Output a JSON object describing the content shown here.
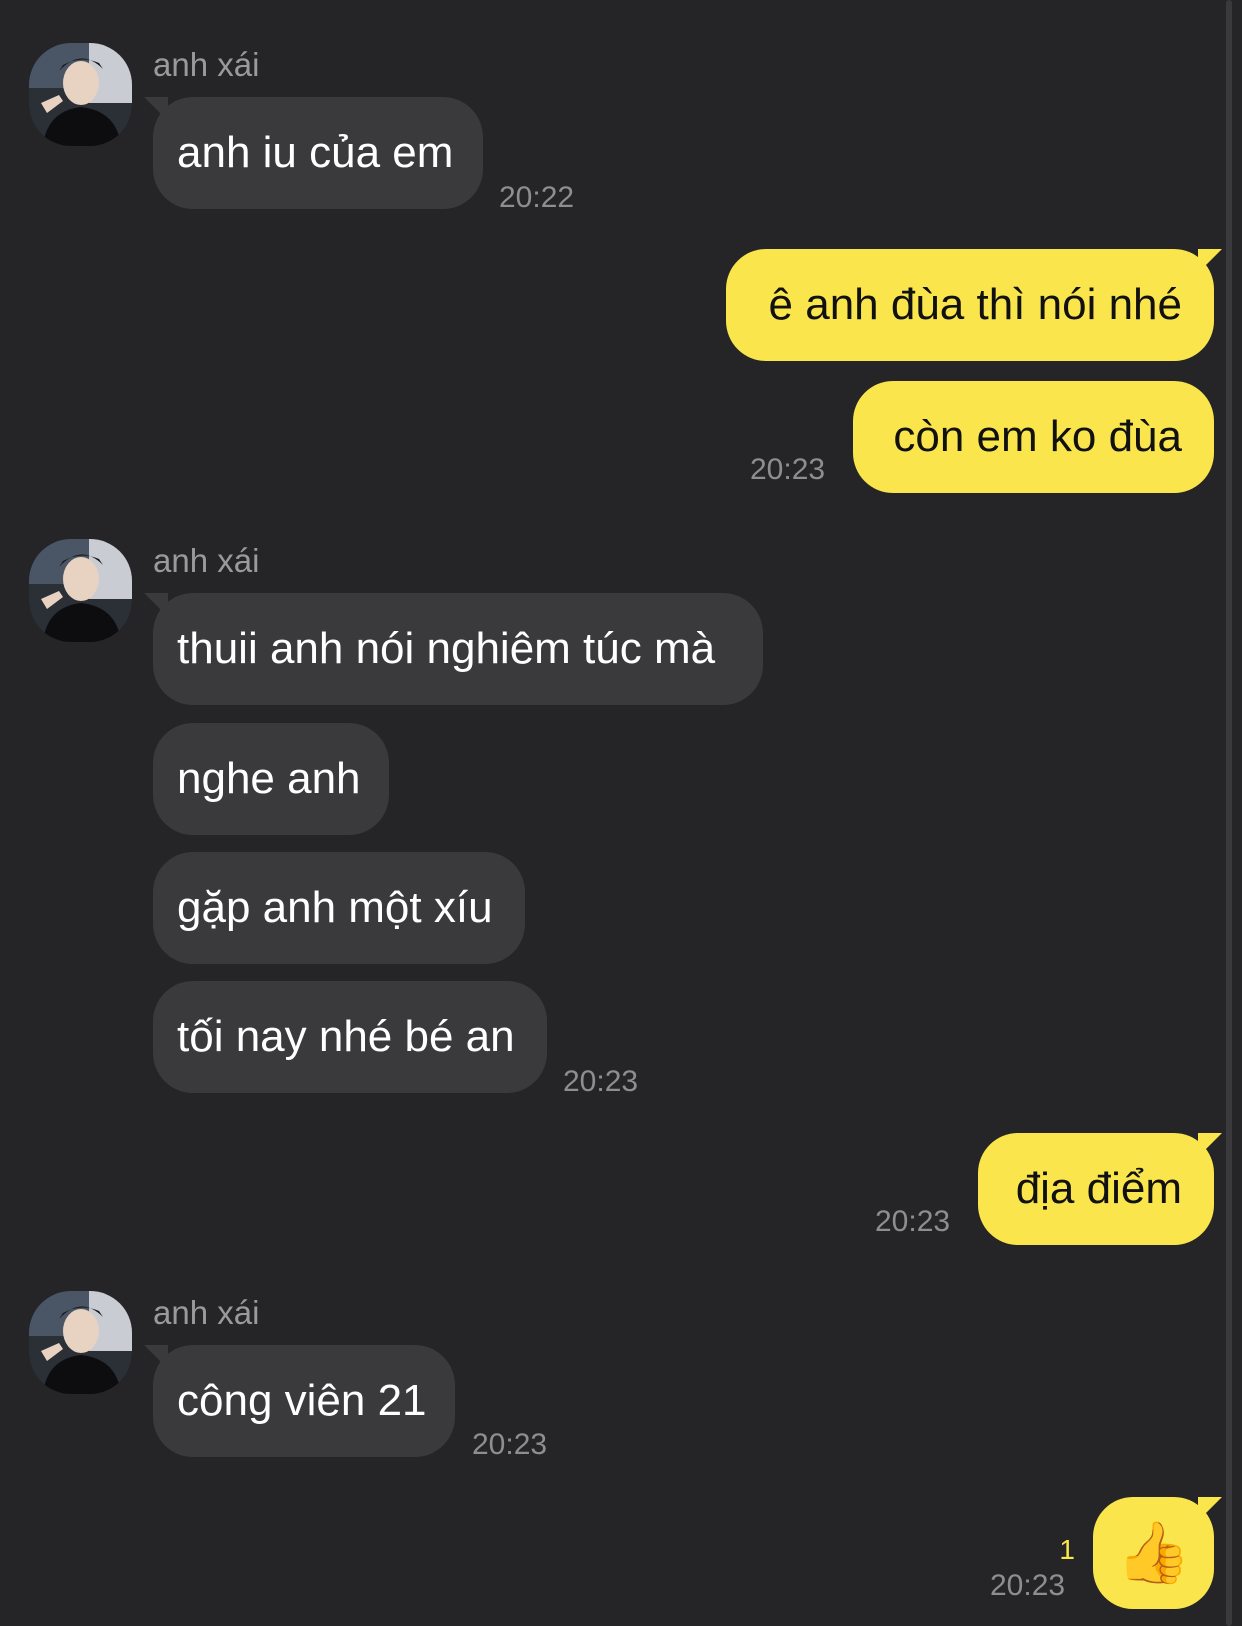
{
  "conversation": {
    "contact_name": "anh xái",
    "groups": [
      {
        "sender": "anh xái",
        "messages": [
          "anh iu của em"
        ],
        "time": "20:22"
      },
      {
        "outgoing": [
          "ê anh đùa thì nói nhé",
          "còn em ko đùa"
        ],
        "time": "20:23"
      },
      {
        "sender": "anh xái",
        "messages": [
          "thuii anh nói nghiêm túc mà",
          "nghe anh",
          "gặp anh một xíu",
          "tối nay nhé bé an"
        ],
        "time": "20:23"
      },
      {
        "outgoing": [
          "địa điểm"
        ],
        "time": "20:23"
      },
      {
        "sender": "anh xái",
        "messages": [
          "công viên 21"
        ],
        "time": "20:23"
      },
      {
        "outgoing_emoji": "👍",
        "emoji_icon": "thumbs-up-icon",
        "unread_count": "1",
        "time": "20:23"
      }
    ]
  },
  "colors": {
    "background": "#252527",
    "incoming_bubble": "#3a3a3c",
    "outgoing_bubble": "#fae64c",
    "timestamp": "#8e8e90",
    "unread": "#fae64c"
  }
}
